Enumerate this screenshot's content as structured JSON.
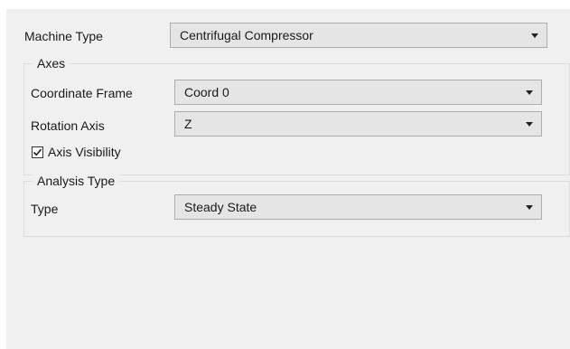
{
  "machine": {
    "label": "Machine Type",
    "value": "Centrifugal Compressor"
  },
  "axes": {
    "title": "Axes",
    "coordinate_frame": {
      "label": "Coordinate Frame",
      "value": "Coord 0"
    },
    "rotation_axis": {
      "label": "Rotation Axis",
      "value": "Z"
    },
    "axis_visibility": {
      "label": "Axis Visibility",
      "checked": true
    }
  },
  "analysis": {
    "title": "Analysis Type",
    "type": {
      "label": "Type",
      "value": "Steady State"
    }
  },
  "icons": {
    "dropdown": "chevron-down-icon",
    "check": "checkmark-icon"
  },
  "colors": {
    "panel_bg": "#f0f0f0",
    "combo_bg": "#e5e5e5",
    "border": "#adadad"
  }
}
